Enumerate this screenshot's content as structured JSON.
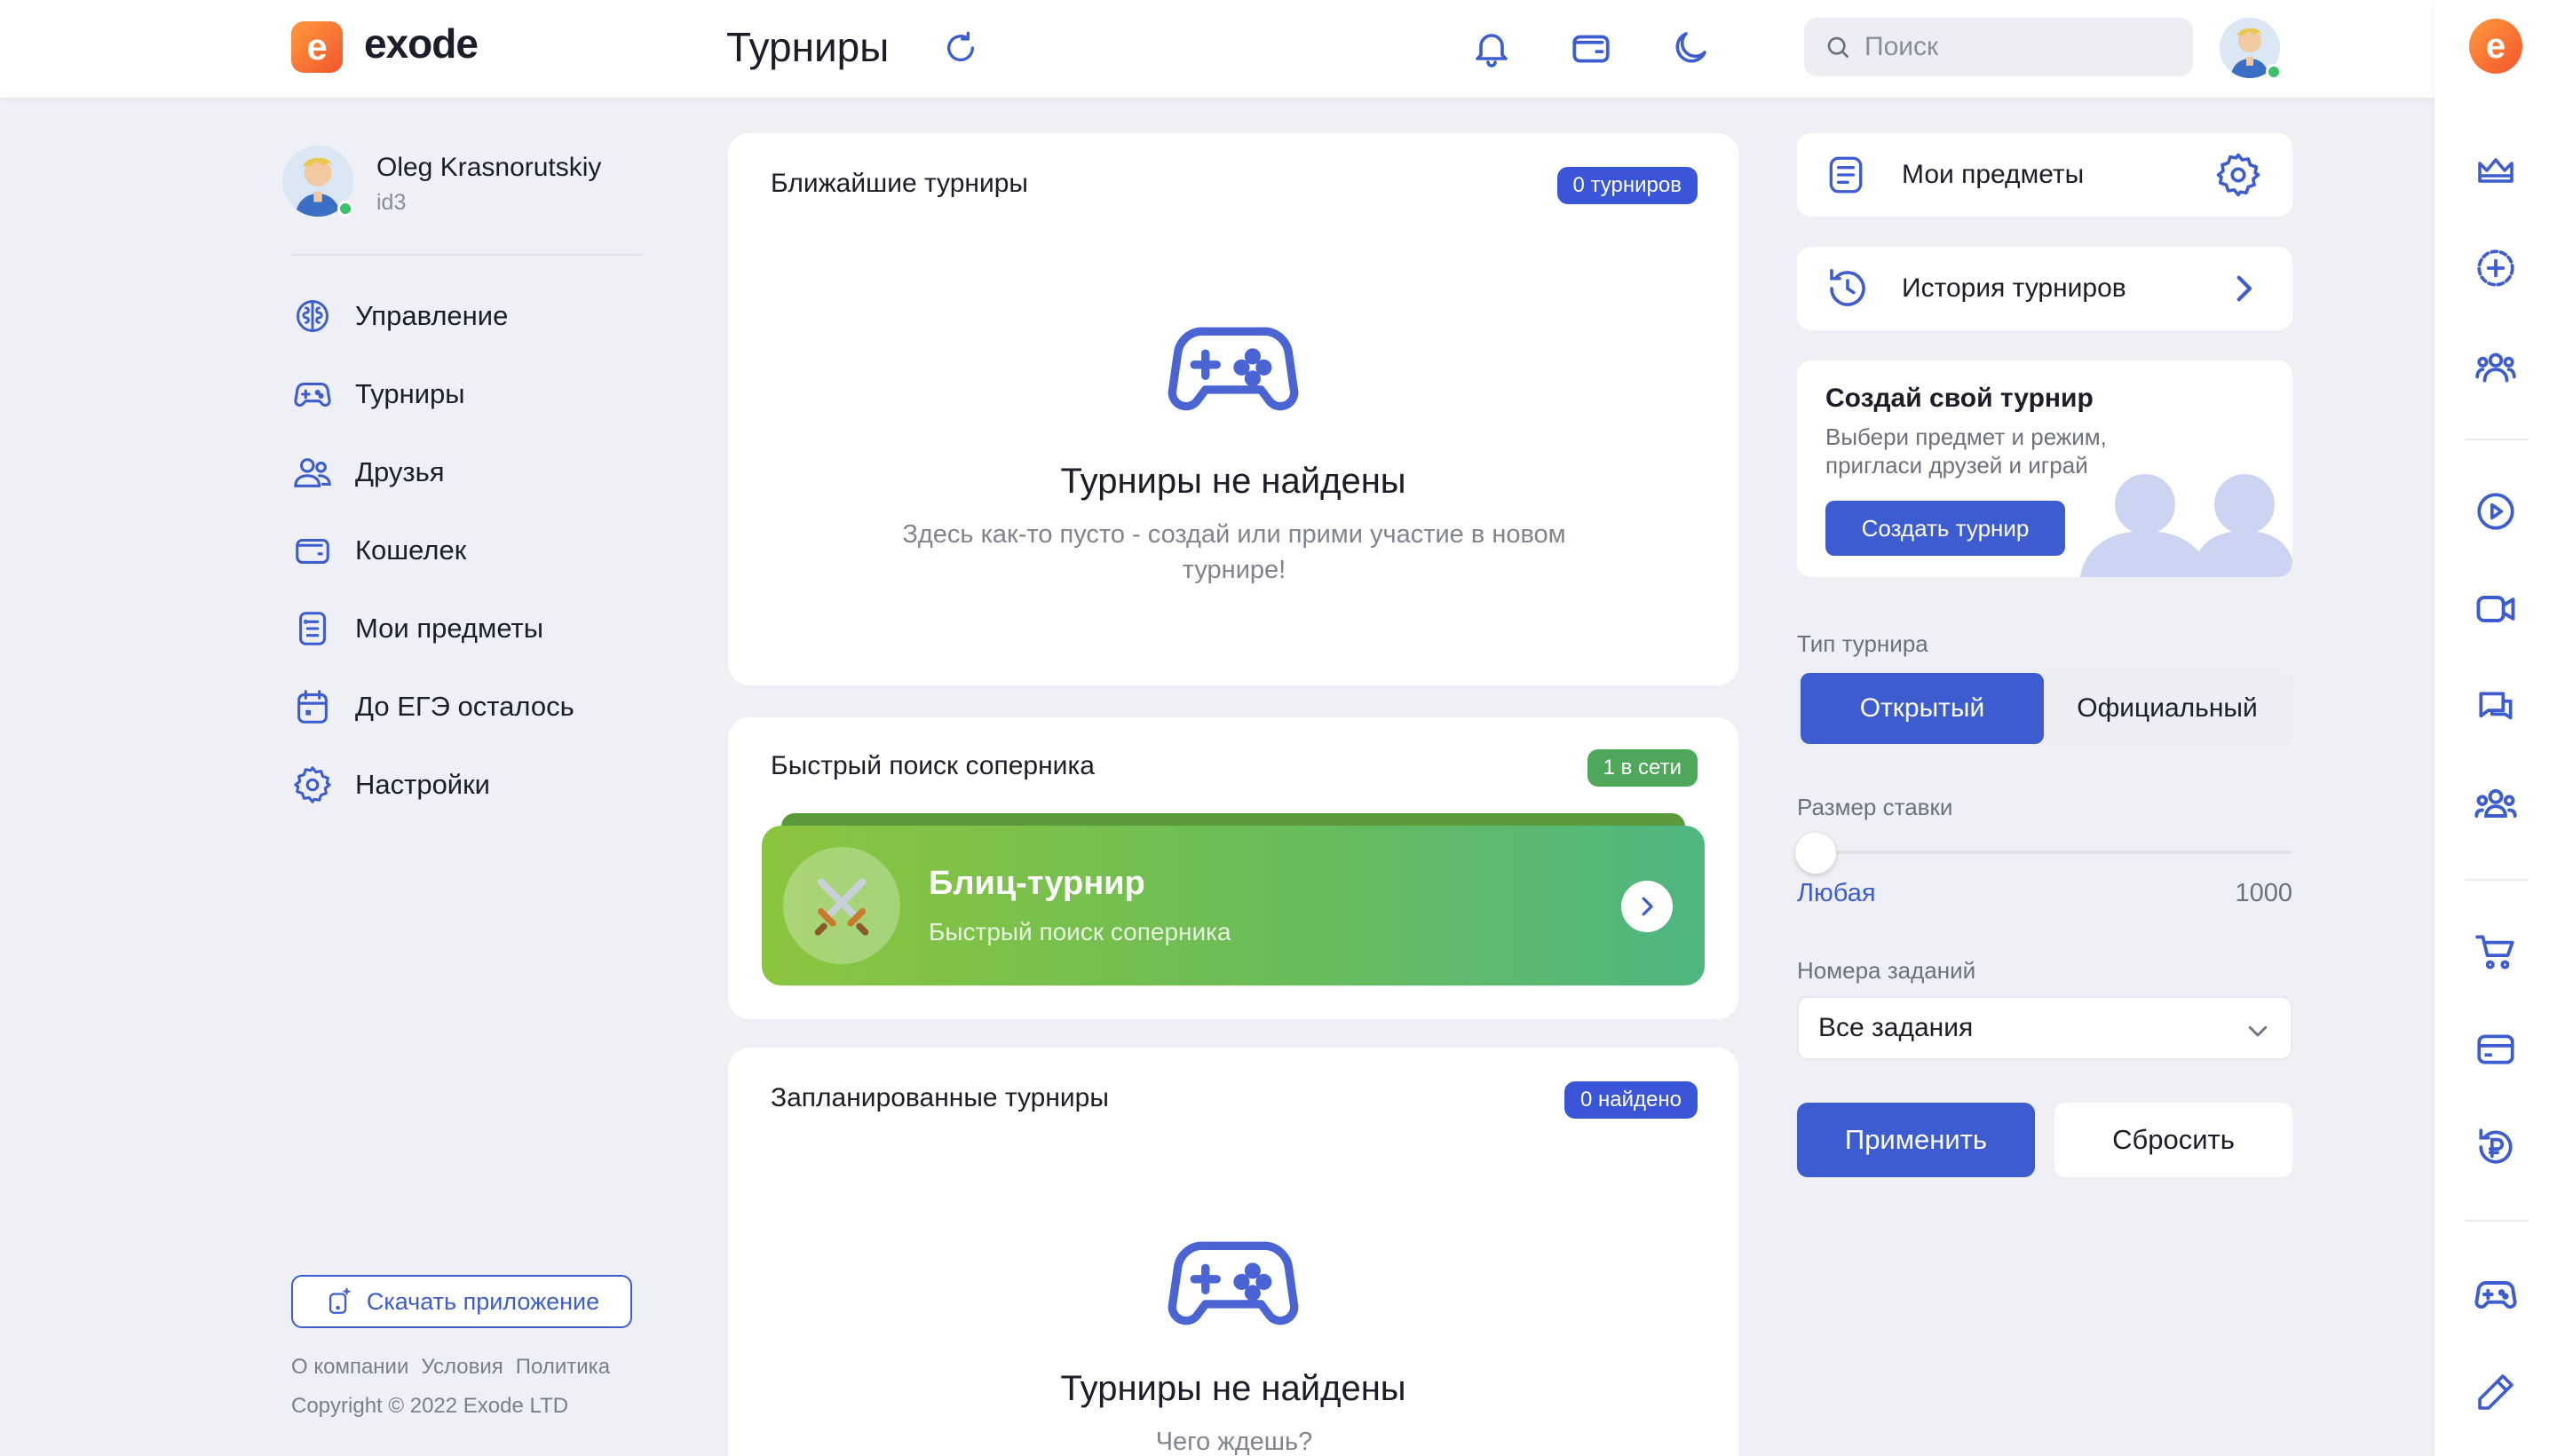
{
  "header": {
    "logo_letter": "e",
    "logo_text": "exode",
    "page_title": "Турниры",
    "search_placeholder": "Поиск"
  },
  "user": {
    "name": "Oleg Krasnorutskiy",
    "id": "id3",
    "online": true
  },
  "sidebar": {
    "items": [
      {
        "label": "Управление",
        "icon": "brain-icon"
      },
      {
        "label": "Турниры",
        "icon": "gamepad-icon"
      },
      {
        "label": "Друзья",
        "icon": "friends-icon"
      },
      {
        "label": "Кошелек",
        "icon": "wallet-icon"
      },
      {
        "label": "Мои предметы",
        "icon": "list-icon"
      },
      {
        "label": "До ЕГЭ осталось",
        "icon": "calendar-icon"
      },
      {
        "label": "Настройки",
        "icon": "gear-icon"
      }
    ],
    "download_label": "Скачать приложение",
    "footer_links": [
      "О компании",
      "Условия",
      "Политика"
    ],
    "copyright": "Copyright © 2022 Exode LTD"
  },
  "upcoming": {
    "title": "Ближайшие турниры",
    "badge": "0 турниров",
    "empty_title": "Турниры не найдены",
    "empty_sub": "Здесь как-то пусто - создай или прими участие в новом турнире!"
  },
  "quick_search": {
    "title": "Быстрый поиск соперника",
    "badge": "1 в сети",
    "blitz_title": "Блиц-турнир",
    "blitz_sub": "Быстрый поиск соперника"
  },
  "scheduled": {
    "title": "Запланированные турниры",
    "badge": "0 найдено",
    "empty_title": "Турниры не найдены",
    "empty_sub": "Чего ждешь?"
  },
  "right_panel": {
    "my_items": "Мои предметы",
    "history": "История турниров",
    "create_title": "Создай свой турнир",
    "create_sub": "Выбери предмет и режим, пригласи друзей и играй",
    "create_button": "Создать турнир",
    "type_label": "Тип турнира",
    "type_options": [
      "Открытый",
      "Официальный"
    ],
    "type_selected": "Открытый",
    "stake_label": "Размер ставки",
    "stake_min_label": "Любая",
    "stake_max_label": "1000",
    "stake_value_fraction": 0,
    "tasks_label": "Номера заданий",
    "tasks_value": "Все задания",
    "apply": "Применить",
    "reset": "Сбросить"
  },
  "colors": {
    "accent": "#3d5ccf",
    "badge_blue": "#3b55d9",
    "badge_green": "#4fa85a",
    "logo_orange": "#f3552c",
    "online": "#3cc068"
  }
}
